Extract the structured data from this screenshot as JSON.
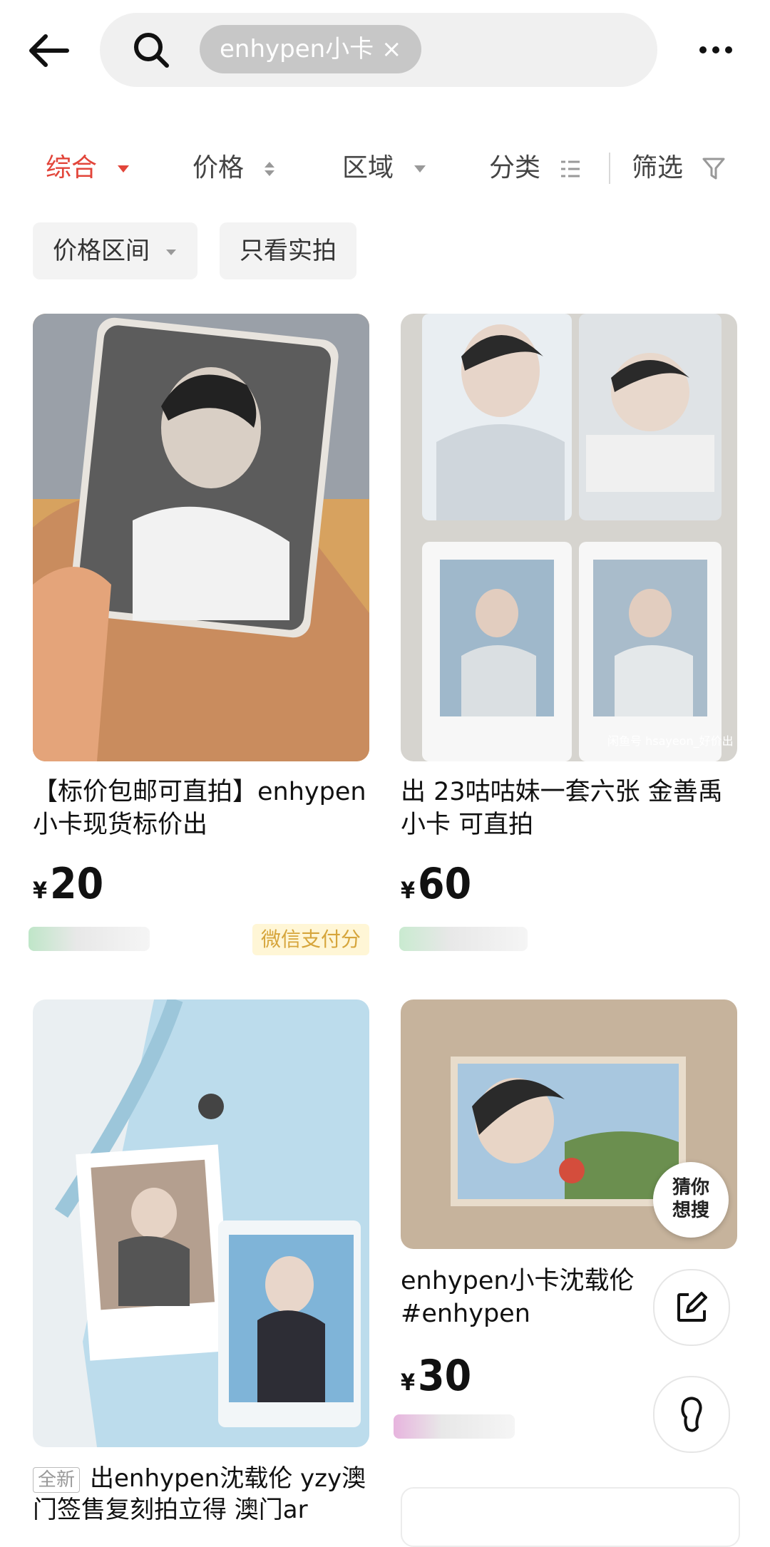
{
  "search": {
    "chip_label": "enhypen小卡 ×"
  },
  "filters": {
    "tabs": [
      {
        "label": "综合"
      },
      {
        "label": "价格"
      },
      {
        "label": "区域"
      },
      {
        "label": "分类"
      },
      {
        "label": "筛选"
      }
    ],
    "pills": [
      {
        "label": "价格区间"
      },
      {
        "label": "只看实拍"
      }
    ]
  },
  "listings": [
    {
      "title": "【标价包邮可直拍】enhypen小卡现货标价出",
      "currency": "¥",
      "price": "20",
      "badge": "微信支付分"
    },
    {
      "title": "出 23咕咕妹一套六张 金善禹小卡 可直拍",
      "currency": "¥",
      "price": "60",
      "watermark": "闲鱼号 hsayeon_好价出"
    },
    {
      "new_tag": "全新",
      "title": "出enhypen沈载伦 yzy澳门签售复刻拍立得 澳门ar"
    },
    {
      "title": "enhypen小卡沈载伦#enhypen",
      "currency": "¥",
      "price": "30",
      "overlay_label": "猜你想搜"
    }
  ],
  "colors": {
    "accent": "#e2453a",
    "badge_bg": "#fff6d6",
    "badge_text": "#d6a53b"
  }
}
